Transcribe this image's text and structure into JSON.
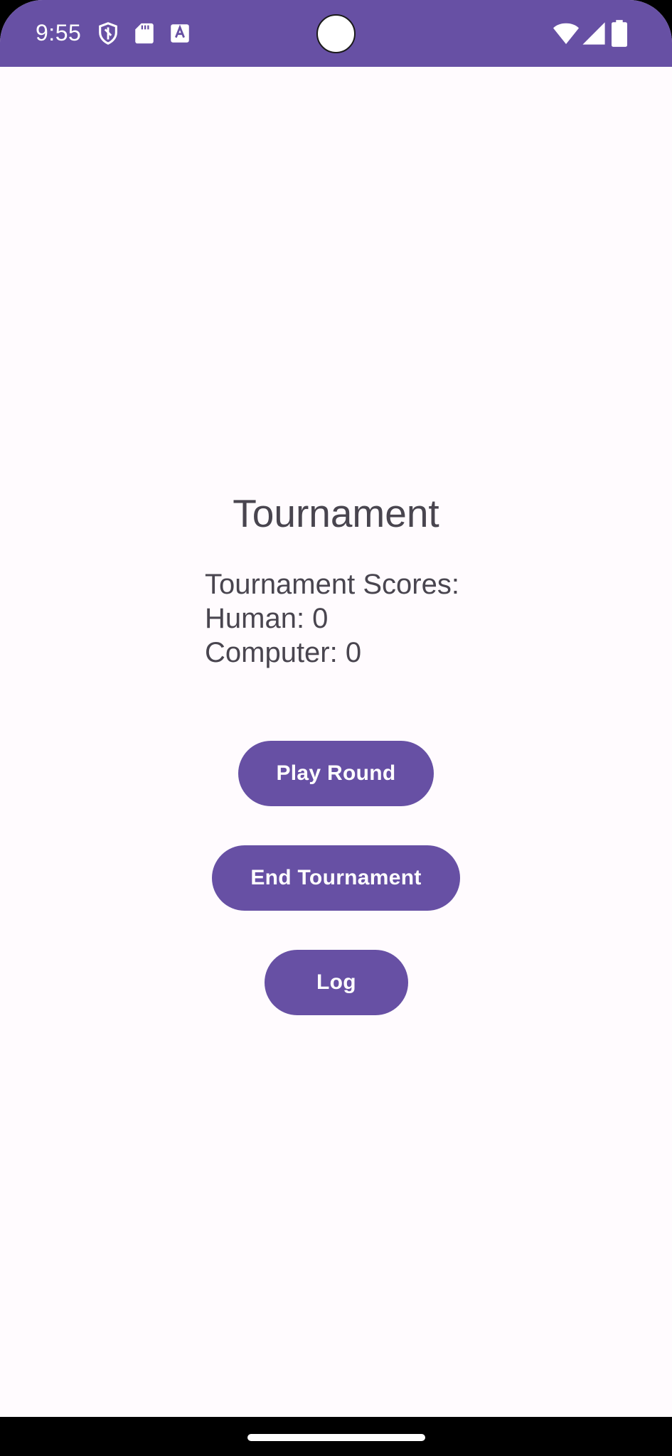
{
  "status_bar": {
    "time": "9:55",
    "color": "#6750A4",
    "left_icons": [
      "shield-icon",
      "sd-card-icon",
      "keyboard-a-icon"
    ],
    "right_icons": [
      "wifi-icon",
      "cellular-signal-icon",
      "battery-icon"
    ]
  },
  "main": {
    "title": "Tournament",
    "scores_heading": "Tournament Scores:",
    "human_score": "Human: 0",
    "computer_score": "Computer: 0"
  },
  "buttons": {
    "play_round": "Play Round",
    "end_tournament": "End Tournament",
    "log": "Log"
  },
  "colors": {
    "accent": "#6750A4",
    "background": "#FFFBFE",
    "text": "#49454F"
  }
}
